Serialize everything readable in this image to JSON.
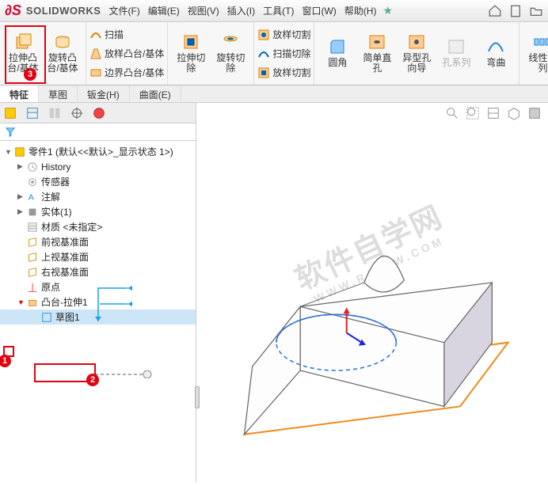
{
  "menu": {
    "brand": "SOLIDWORKS",
    "file": "文件(F)",
    "edit": "编辑(E)",
    "view": "视图(V)",
    "insert": "插入(I)",
    "tools": "工具(T)",
    "window": "窗口(W)",
    "help": "帮助(H)"
  },
  "ribbon": {
    "extrude_boss": "拉伸凸\n台/基体",
    "revolve_boss": "旋转凸\n台/基体",
    "sweep": "扫描",
    "loft_boss": "放样凸台/基体",
    "boundary_boss": "边界凸台/基体",
    "extrude_cut": "拉伸切\n除",
    "revolve_cut": "旋转切\n除",
    "loft_cut": "放样切割",
    "sweep_cut": "扫描切除",
    "loft_cut2": "放样切割",
    "fillet": "圆角",
    "simple_hole": "简单直\n孔",
    "hole_wizard": "异型孔\n向导",
    "hole_series": "孔系列",
    "curve": "弯曲",
    "linear_pattern": "线性阵\n列"
  },
  "tabs": {
    "features": "特征",
    "sketch": "草图",
    "sheetmetal": "钣金(H)",
    "surface": "曲面(E)"
  },
  "tree": {
    "root": "零件1 (默认<<默认>_显示状态 1>)",
    "history": "History",
    "sensors": "传感器",
    "annotations": "注解",
    "solids": "实体(1)",
    "material": "材质 <未指定>",
    "front_plane": "前视基准面",
    "top_plane": "上视基准面",
    "right_plane": "右视基准面",
    "origin": "原点",
    "boss_extrude": "凸台-拉伸1",
    "sketch1": "草图1"
  },
  "badges": {
    "b1": "1",
    "b2": "2",
    "b3": "3"
  },
  "watermark": {
    "main": "软件自学网",
    "sub": "WWW.RJZXW.COM"
  },
  "chart_data": null
}
